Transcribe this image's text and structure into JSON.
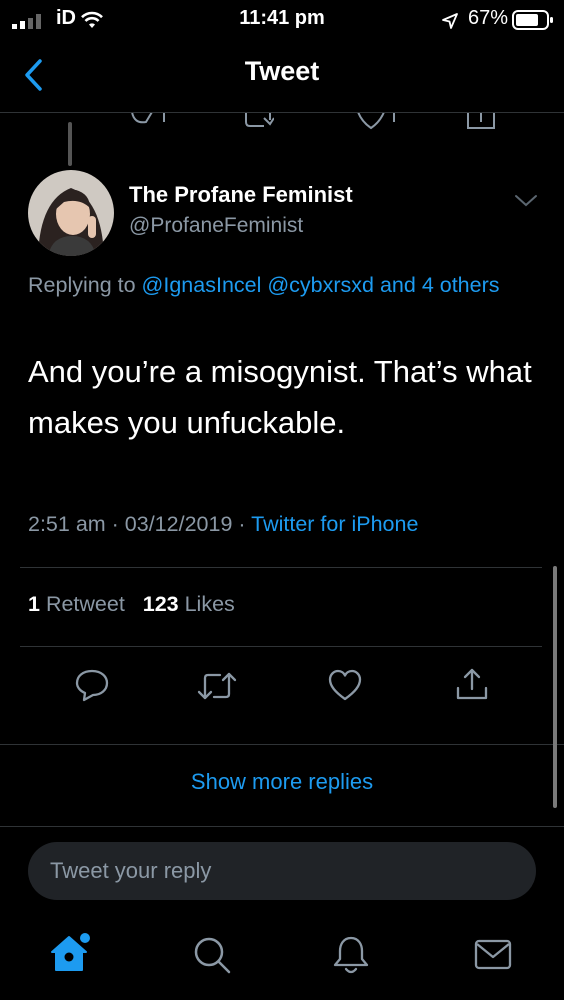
{
  "status_bar": {
    "carrier": "iD",
    "time": "11:41 pm",
    "battery": "67%"
  },
  "nav": {
    "title": "Tweet"
  },
  "tweet": {
    "author_name": "The Profane Feminist",
    "author_handle": "@ProfaneFeminist",
    "replying_prefix": "Replying to ",
    "replying_mentions": "@IgnasIncel @cybxrsxd and 4 others",
    "text": "And you’re a misogynist. That’s what makes you unfuckable.",
    "timestamp": "2:51 am · 03/12/2019 · ",
    "source": "Twitter for iPhone",
    "retweet_count": "1",
    "retweet_label": " Retweet",
    "like_count": "123",
    "like_label": " Likes"
  },
  "replies": {
    "show_more": "Show more replies"
  },
  "composer": {
    "placeholder": "Tweet your reply"
  },
  "tab_bar": {
    "items": [
      "home-icon",
      "search-icon",
      "notifications-icon",
      "messages-icon"
    ]
  },
  "colors": {
    "accent": "#1d9bf0",
    "secondary_text": "#8b98a5",
    "background": "#000000"
  }
}
